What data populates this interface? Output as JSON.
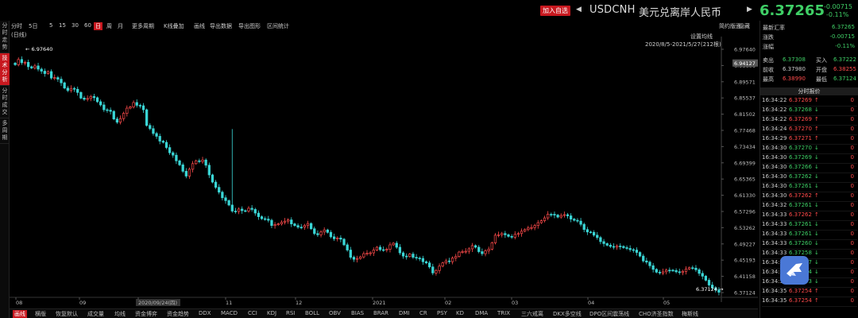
{
  "header": {
    "add_button": "加入自选",
    "prev_icon": "triangle-left-icon",
    "next_icon": "triangle-right-icon",
    "symbol": "USDCNH",
    "name_cn": "美元兑离岸人民币",
    "price": "6.37265",
    "change": "-0.00715",
    "change_pct": "-0.11%"
  },
  "sidebar": [
    {
      "label": "分时走势"
    },
    {
      "label": "技术分析",
      "active": true
    },
    {
      "label": "分时成交"
    },
    {
      "label": "多周期"
    }
  ],
  "toolbar": {
    "items": [
      "分时",
      "5日",
      "5",
      "15",
      "30",
      "60",
      "日",
      "周",
      "月",
      "更多周期",
      "K线叠加",
      "画线",
      "导出数据",
      "导出图形",
      "区间统计"
    ],
    "active": "日",
    "right1": "简约版面",
    "right2": "隐藏"
  },
  "chart_header": {
    "period": "(日线)",
    "ma_settings": "设置均线",
    "range": "2020/8/5-2021/5/27(212根)"
  },
  "chart_data": {
    "type": "candlestick",
    "y_ticks": [
      "6.97640",
      "6.93606",
      "6.89571",
      "6.85537",
      "6.81502",
      "6.77468",
      "6.73434",
      "6.69399",
      "6.65365",
      "6.61330",
      "6.57296",
      "6.53262",
      "6.49227",
      "6.45193",
      "6.41158",
      "6.37124"
    ],
    "ylim": [
      6.37124,
      6.9764
    ],
    "x_ticks": [
      "08",
      "09",
      "2020/09/24(四)",
      "11",
      "12",
      "2021",
      "02",
      "03",
      "04",
      "05"
    ],
    "highlight_price": "6.94127",
    "high_label": "6.97640",
    "low_label": "6.37124",
    "up_color": "#ff4b4b",
    "down_color": "#3ad6d6",
    "closes": [
      6.938,
      6.951,
      6.943,
      6.944,
      6.933,
      6.93,
      6.935,
      6.927,
      6.922,
      6.916,
      6.921,
      6.905,
      6.906,
      6.902,
      6.893,
      6.88,
      6.874,
      6.879,
      6.877,
      6.869,
      6.855,
      6.852,
      6.854,
      6.859,
      6.856,
      6.846,
      6.838,
      6.826,
      6.825,
      6.822,
      6.803,
      6.795,
      6.804,
      6.817,
      6.83,
      6.833,
      6.844,
      6.837,
      6.836,
      6.826,
      6.787,
      6.779,
      6.767,
      6.76,
      6.748,
      6.745,
      6.732,
      6.719,
      6.713,
      6.699,
      6.689,
      6.673,
      6.661,
      6.678,
      6.692,
      6.699,
      6.697,
      6.701,
      6.688,
      6.664,
      6.646,
      6.633,
      6.621,
      6.607,
      6.6,
      6.589,
      6.574,
      6.573,
      6.579,
      6.575,
      6.574,
      6.581,
      6.578,
      6.569,
      6.56,
      6.555,
      6.554,
      6.551,
      6.538,
      6.54,
      6.542,
      6.546,
      6.549,
      6.552,
      6.542,
      6.538,
      6.534,
      6.534,
      6.538,
      6.543,
      6.53,
      6.518,
      6.515,
      6.522,
      6.527,
      6.521,
      6.51,
      6.505,
      6.507,
      6.504,
      6.49,
      6.477,
      6.459,
      6.454,
      6.456,
      6.46,
      6.468,
      6.469,
      6.47,
      6.477,
      6.484,
      6.478,
      6.478,
      6.479,
      6.49,
      6.494,
      6.484,
      6.47,
      6.462,
      6.461,
      6.467,
      6.459,
      6.457,
      6.456,
      6.448,
      6.445,
      6.435,
      6.42,
      6.426,
      6.437,
      6.445,
      6.45,
      6.448,
      6.457,
      6.461,
      6.472,
      6.473,
      6.474,
      6.48,
      6.488,
      6.484,
      6.473,
      6.468,
      6.475,
      6.479,
      6.495,
      6.514,
      6.515,
      6.518,
      6.515,
      6.511,
      6.509,
      6.516,
      6.518,
      6.524,
      6.528,
      6.532,
      6.533,
      6.538,
      6.545,
      6.55,
      6.557,
      6.566,
      6.566,
      6.564,
      6.559,
      6.563,
      6.565,
      6.562,
      6.554,
      6.551,
      6.549,
      6.541,
      6.528,
      6.522,
      6.521,
      6.514,
      6.508,
      6.498,
      6.493,
      6.489,
      6.486,
      6.484,
      6.487,
      6.486,
      6.483,
      6.481,
      6.478,
      6.477,
      6.471,
      6.462,
      6.45,
      6.447,
      6.438,
      6.429,
      6.422,
      6.42,
      6.423,
      6.427,
      6.427,
      6.426,
      6.423,
      6.421,
      6.424,
      6.43,
      6.433,
      6.432,
      6.428,
      6.419,
      6.412,
      6.402,
      6.39,
      6.383,
      6.378,
      6.372
    ],
    "wick_spike": 6.778,
    "spike_index": 66
  },
  "bottom_tabs": {
    "items": [
      "画线",
      "横版",
      "恢复默认",
      "成交量",
      "均线",
      "资金博弈",
      "资金趋势",
      "DDX",
      "MACD",
      "CCI",
      "KDJ",
      "RSI",
      "BOLL",
      "OBV",
      "BIAS",
      "BRAR",
      "DMI",
      "CR",
      "PSY",
      "KD",
      "DMA",
      "TRIX",
      "三六戒离",
      "DKX多空线",
      "DPO区间震荡线",
      "CHO济圣指数",
      "梅斯线"
    ],
    "active": "画线"
  },
  "right_panel": {
    "labels": {
      "latest": "最新汇率",
      "change": "涨跌",
      "pct": "涨幅",
      "sell": "卖出",
      "buy": "买入",
      "prev": "前收",
      "open": "开盘",
      "high": "最高",
      "low": "最低"
    },
    "latest": "6.37265",
    "change": "-0.00715",
    "pct": "-0.11%",
    "sell": "6.37308",
    "buy": "6.37222",
    "prev": "6.37980",
    "open": "6.38255",
    "high": "6.38990",
    "low": "6.37124",
    "tick_title": "分时报价",
    "ticks": [
      {
        "time": "16:34:22",
        "price": "6.37269",
        "arrow": "↑",
        "vol": "0",
        "dir": "up"
      },
      {
        "time": "16:34:22",
        "price": "6.37268",
        "arrow": "↓",
        "vol": "0",
        "dir": "down"
      },
      {
        "time": "16:34:22",
        "price": "6.37269",
        "arrow": "↑",
        "vol": "0",
        "dir": "up"
      },
      {
        "time": "16:34:24",
        "price": "6.37270",
        "arrow": "↑",
        "vol": "0",
        "dir": "up"
      },
      {
        "time": "16:34:29",
        "price": "6.37271",
        "arrow": "↑",
        "vol": "0",
        "dir": "up"
      },
      {
        "time": "16:34:30",
        "price": "6.37270",
        "arrow": "↓",
        "vol": "0",
        "dir": "down"
      },
      {
        "time": "16:34:30",
        "price": "6.37269",
        "arrow": "↓",
        "vol": "0",
        "dir": "down"
      },
      {
        "time": "16:34:30",
        "price": "6.37266",
        "arrow": "↓",
        "vol": "0",
        "dir": "down"
      },
      {
        "time": "16:34:30",
        "price": "6.37262",
        "arrow": "↓",
        "vol": "0",
        "dir": "down"
      },
      {
        "time": "16:34:30",
        "price": "6.37261",
        "arrow": "↓",
        "vol": "0",
        "dir": "down"
      },
      {
        "time": "16:34:30",
        "price": "6.37262",
        "arrow": "↑",
        "vol": "0",
        "dir": "up"
      },
      {
        "time": "16:34:32",
        "price": "6.37261",
        "arrow": "↓",
        "vol": "0",
        "dir": "down"
      },
      {
        "time": "16:34:33",
        "price": "6.37262",
        "arrow": "↑",
        "vol": "0",
        "dir": "up"
      },
      {
        "time": "16:34:33",
        "price": "6.37261",
        "arrow": "↓",
        "vol": "0",
        "dir": "down"
      },
      {
        "time": "16:34:33",
        "price": "6.37261",
        "arrow": "↓",
        "vol": "0",
        "dir": "down"
      },
      {
        "time": "16:34:33",
        "price": "6.37260",
        "arrow": "↓",
        "vol": "0",
        "dir": "down"
      },
      {
        "time": "16:34:33",
        "price": "6.37258",
        "arrow": "↓",
        "vol": "0",
        "dir": "down"
      },
      {
        "time": "16:34:33",
        "price": "6.37257",
        "arrow": "↓",
        "vol": "0",
        "dir": "down"
      },
      {
        "time": "16:34:34",
        "price": "6.37254",
        "arrow": "↓",
        "vol": "0",
        "dir": "down"
      },
      {
        "time": "16:34:35",
        "price": "6.37253",
        "arrow": "↓",
        "vol": "0",
        "dir": "down"
      },
      {
        "time": "16:34:35",
        "price": "6.37254",
        "arrow": "↑",
        "vol": "0",
        "dir": "up"
      },
      {
        "time": "16:34:35",
        "price": "6.37254",
        "arrow": "↑",
        "vol": "0",
        "dir": "up"
      }
    ]
  },
  "badge": {
    "icon": "bird-logo-icon",
    "color": "#4a78d6"
  }
}
